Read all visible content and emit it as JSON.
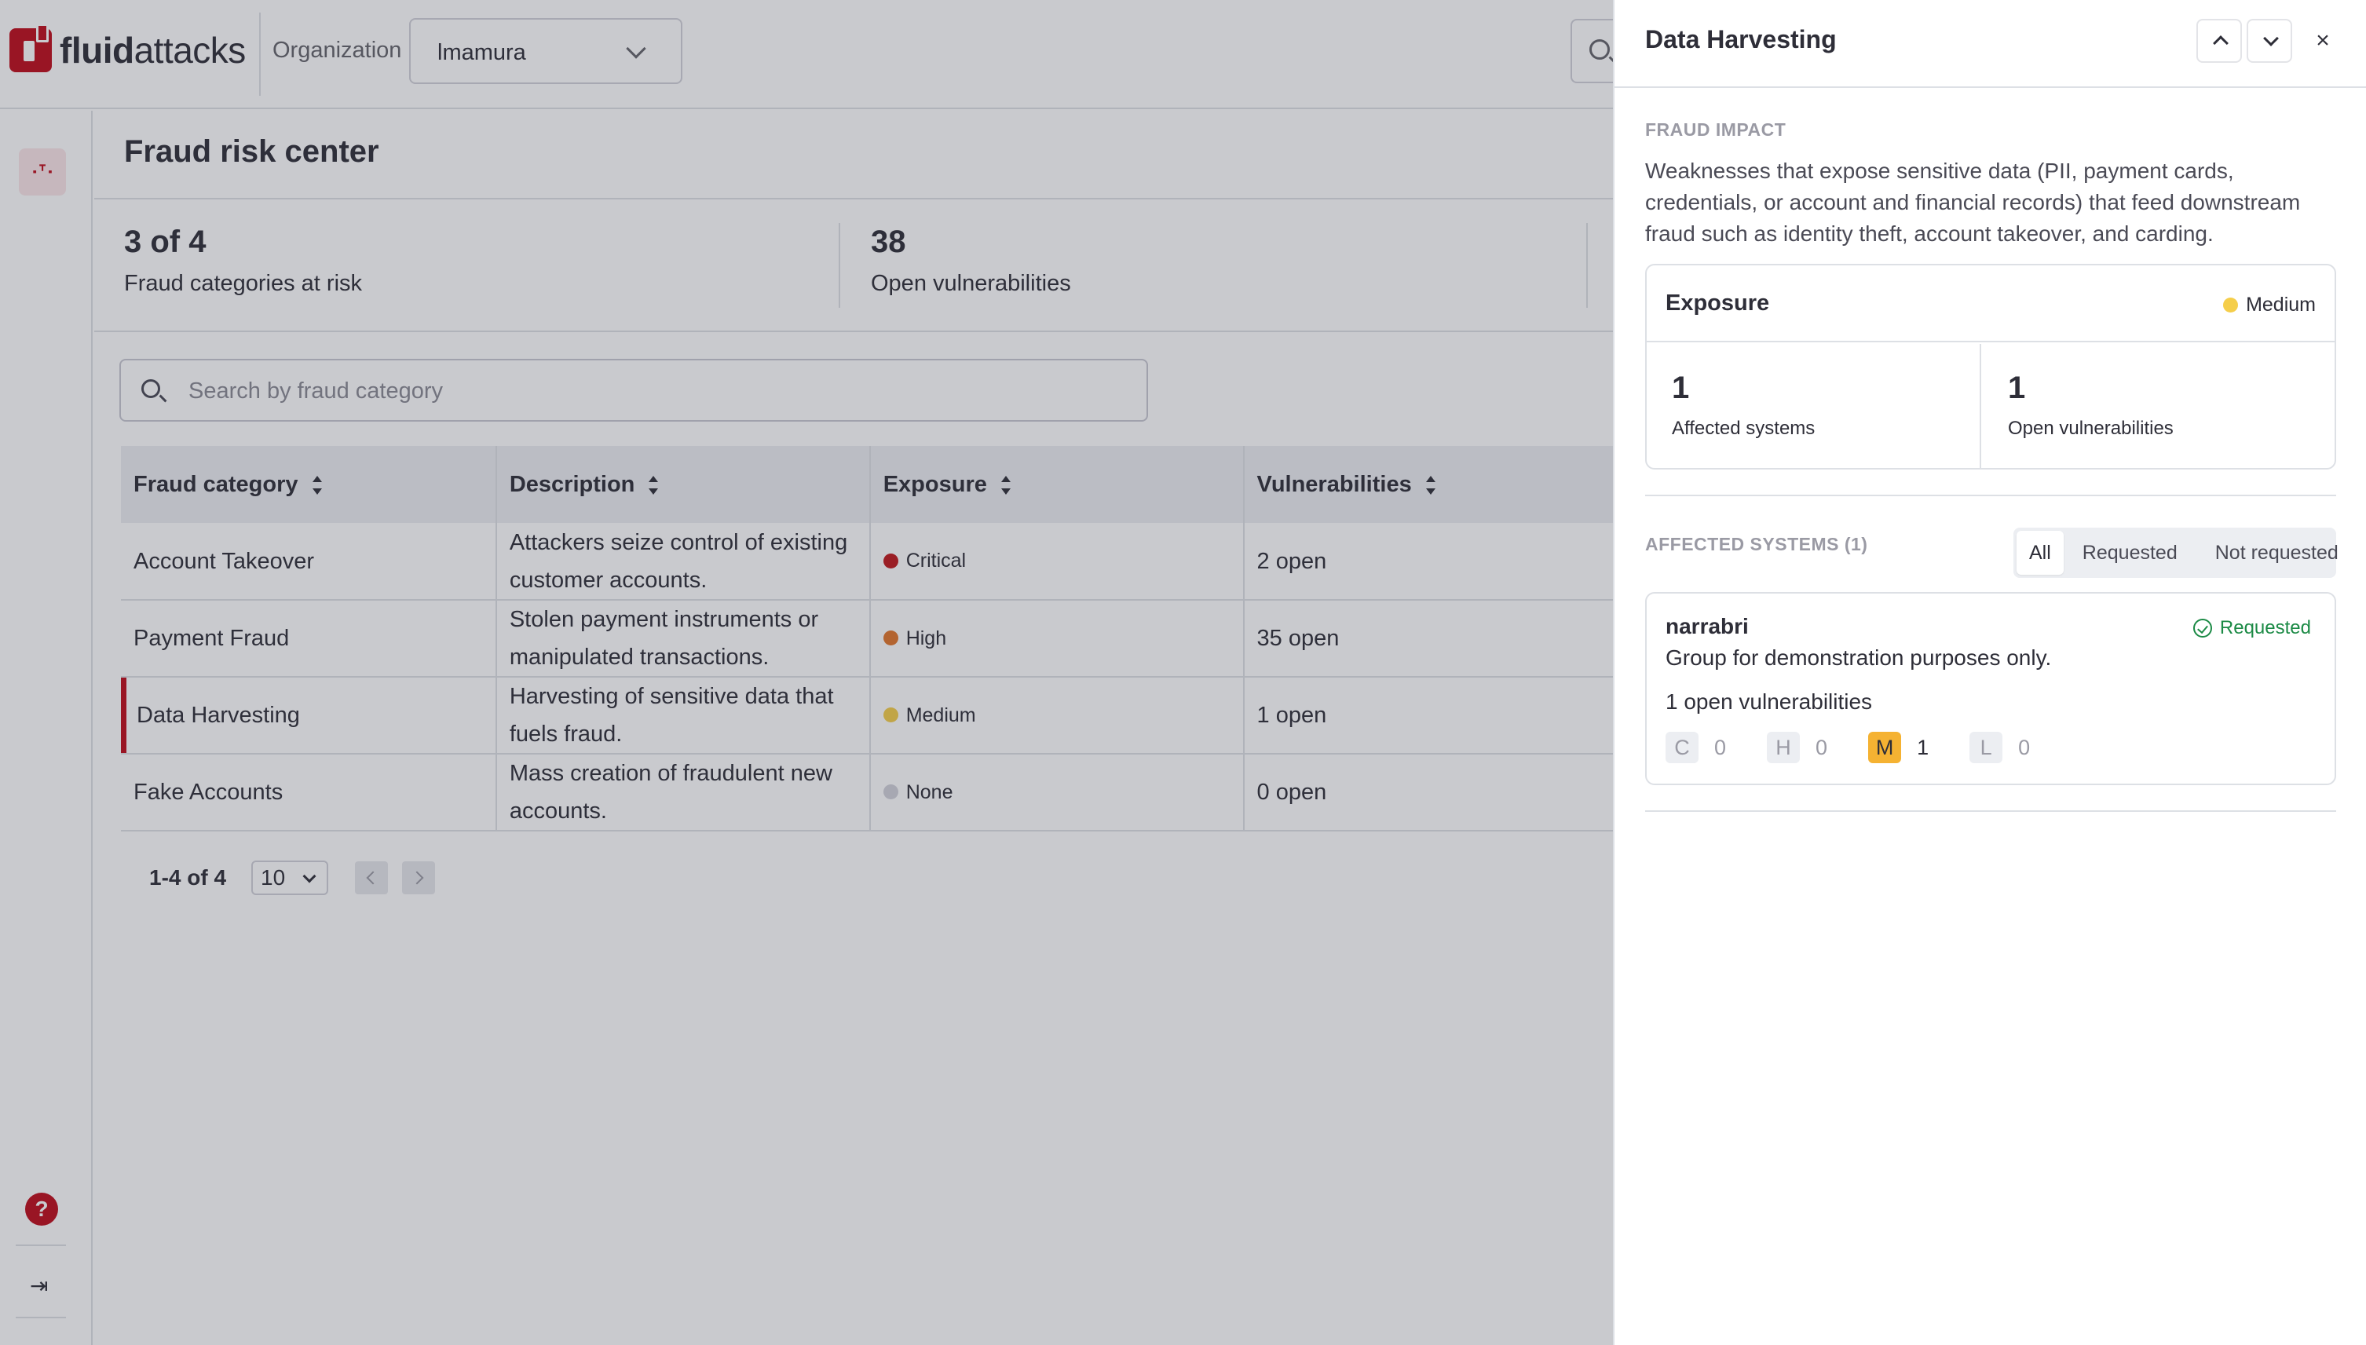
{
  "brand": {
    "logo_bold": "fluid",
    "logo_rest": "attacks"
  },
  "header": {
    "org_label": "Organization",
    "org_value": "lmamura"
  },
  "sidebar": {
    "nav_icon": "radar-antenna-icon",
    "help_glyph": "?",
    "collapse_glyph": "⇥"
  },
  "page": {
    "title": "Fraud risk center",
    "stats": [
      {
        "value": "3 of 4",
        "label": "Fraud categories at risk"
      },
      {
        "value": "38",
        "label": "Open vulnerabilities"
      }
    ],
    "search_placeholder": "Search by fraud category"
  },
  "table": {
    "columns": [
      "Fraud category",
      "Description",
      "Exposure",
      "Vulnerabilities"
    ],
    "rows": [
      {
        "category": "Account Takeover",
        "description": "Attackers seize control of existing customer accounts.",
        "exposure": "Critical",
        "exposure_color": "#c0171c",
        "vulns": "2 open"
      },
      {
        "category": "Payment Fraud",
        "description": "Stolen payment instruments or manipulated transactions.",
        "exposure": "High",
        "exposure_color": "#e2762b",
        "vulns": "35 open"
      },
      {
        "category": "Data Harvesting",
        "description": "Harvesting of sensitive data that fuels fraud.",
        "exposure": "Medium",
        "exposure_color": "#f5ce4a",
        "vulns": "1 open",
        "selected": true
      },
      {
        "category": "Fake Accounts",
        "description": "Mass creation of fraudulent new accounts.",
        "exposure": "None",
        "exposure_color": "#d2d2da",
        "vulns": "0 open"
      }
    ],
    "pagination": {
      "range": "1-4 of 4",
      "page_size": "10"
    }
  },
  "panel": {
    "title": "Data Harvesting",
    "close_glyph": "×",
    "impact_caption": "FRAUD IMPACT",
    "impact_text": "Weaknesses that expose sensitive data (PII, payment cards, credentials, or account and financial records) that feed downstream fraud such as identity theft, account takeover, and carding.",
    "exposure": {
      "title": "Exposure",
      "level": "Medium",
      "level_color": "#f5ce4a",
      "affected_systems": {
        "value": "1",
        "label": "Affected systems"
      },
      "open_vulns": {
        "value": "1",
        "label": "Open vulnerabilities"
      }
    },
    "affected_caption": "AFFECTED SYSTEMS (1)",
    "filter_tabs": [
      "All",
      "Requested",
      "Not requested"
    ],
    "active_filter": "All",
    "system": {
      "name": "narrabri",
      "status": "Requested",
      "status_color": "#1b8a45",
      "description": "Group for demonstration purposes only.",
      "open_vulns": "1 open vulnerabilities",
      "severity": [
        {
          "letter": "C",
          "count": "0"
        },
        {
          "letter": "H",
          "count": "0"
        },
        {
          "letter": "M",
          "count": "1"
        },
        {
          "letter": "L",
          "count": "0"
        }
      ]
    }
  },
  "colors": {
    "brand_red": "#bf0b1a",
    "medium_badge": "#f5b232"
  }
}
